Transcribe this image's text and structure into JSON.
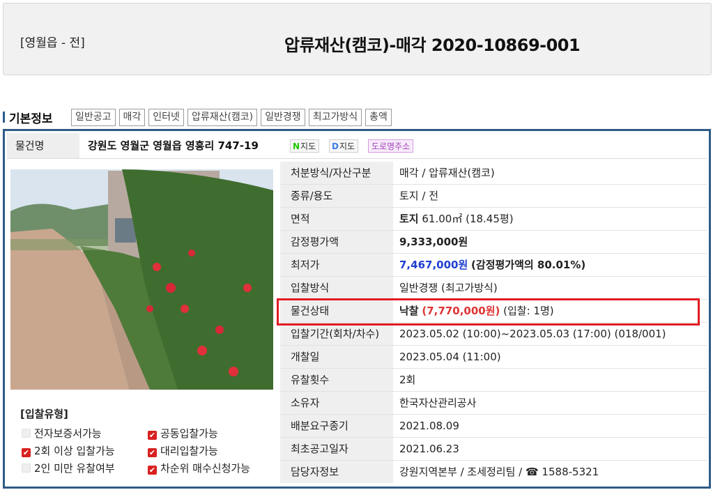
{
  "header": {
    "location": "[영월읍 - 전]",
    "title": "압류재산(캠코)-매각 2020-10869-001"
  },
  "section": {
    "title": "기본정보",
    "tags": [
      "일반공고",
      "매각",
      "인터넷",
      "압류재산(캠코)",
      "일반경쟁",
      "최고가방식",
      "총액"
    ]
  },
  "property": {
    "name_label": "물건명",
    "name": "강원도 영월군 영월읍 영흥리 747-19",
    "naver_map": {
      "glyph": "N",
      "label": "지도"
    },
    "daum_map": {
      "glyph": "D",
      "label": "지도"
    },
    "road_address": "도로명주소"
  },
  "bid_types": {
    "title": "[입찰유형]",
    "options": [
      {
        "label": "전자보증서가능",
        "checked": false
      },
      {
        "label": "공동입찰가능",
        "checked": true
      },
      {
        "label": "2회 이상 입찰가능",
        "checked": true
      },
      {
        "label": "대리입찰가능",
        "checked": true
      },
      {
        "label": "2인 미만 유찰여부",
        "checked": false
      },
      {
        "label": "차순위 매수신청가능",
        "checked": true
      }
    ]
  },
  "details": {
    "disposal": {
      "label": "처분방식/자산구분",
      "value": "매각 / 압류재산(캠코)"
    },
    "type": {
      "label": "종류/용도",
      "value": "토지 / 전"
    },
    "area": {
      "label": "면적",
      "value_bold": "토지",
      "value": "61.00㎡ (18.45평)"
    },
    "appraisal": {
      "label": "감정평가액",
      "value": "9,333,000원"
    },
    "minimum": {
      "label": "최저가",
      "value_price": "7,467,000원",
      "value_note": "(감정평가액의 80.01%)"
    },
    "method": {
      "label": "입찰방식",
      "value": "일반경쟁 (최고가방식)"
    },
    "status": {
      "label": "물건상태",
      "value_state": "낙찰",
      "value_price": "(7,770,000원)",
      "value_note": "(입찰: 1명)"
    },
    "period": {
      "label": "입찰기간(회차/차수)",
      "value": "2023.05.02 (10:00)~2023.05.03 (17:00) (018/001)"
    },
    "opening": {
      "label": "개찰일",
      "value": "2023.05.04 (11:00)"
    },
    "failed": {
      "label": "유찰횟수",
      "value": "2회"
    },
    "owner": {
      "label": "소유자",
      "value": "한국자산관리공사"
    },
    "deadline": {
      "label": "배분요구종기",
      "value": "2021.08.09"
    },
    "first_notice": {
      "label": "최초공고일자",
      "value": "2021.06.23"
    },
    "contact": {
      "label": "담당자정보",
      "value": "강원지역본부 / 조세정리팀 / ☎ 1588-5321"
    }
  },
  "colors": {
    "accent_border": "#2e5b86",
    "price_blue": "#1f3fd1",
    "status_red": "#e03434",
    "check_red": "#d92020"
  }
}
